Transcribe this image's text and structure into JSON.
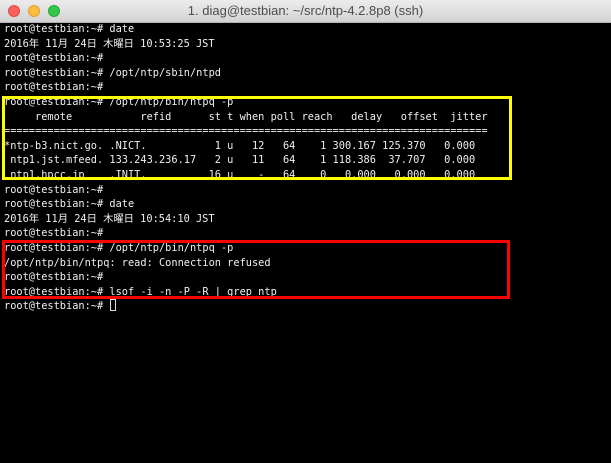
{
  "window": {
    "title": "1. diag@testbian: ~/src/ntp-4.2.8p8 (ssh)"
  },
  "terminal": {
    "lines": [
      "root@testbian:~# date",
      "2016年 11月 24日 木曜日 10:53:25 JST",
      "root@testbian:~#",
      "root@testbian:~# /opt/ntp/sbin/ntpd",
      "root@testbian:~#",
      "root@testbian:~# /opt/ntp/bin/ntpq -p",
      "     remote           refid      st t when poll reach   delay   offset  jitter",
      "==============================================================================",
      "*ntp-b3.nict.go. .NICT.           1 u   12   64    1 300.167 125.370   0.000",
      " ntp1.jst.mfeed. 133.243.236.17   2 u   11   64    1 118.386  37.707   0.000",
      " ntp1.hpcc.jp    .INIT.          16 u    -   64    0   0.000   0.000   0.000",
      "root@testbian:~#",
      "root@testbian:~# date",
      "2016年 11月 24日 木曜日 10:54:10 JST",
      "root@testbian:~#",
      "root@testbian:~# /opt/ntp/bin/ntpq -p",
      "/opt/ntp/bin/ntpq: read: Connection refused",
      "root@testbian:~#",
      "root@testbian:~# lsof -i -n -P -R | grep ntp",
      "root@testbian:~# "
    ]
  },
  "colors": {
    "highlight_1": "#ffff00",
    "highlight_2": "#ff0000"
  }
}
